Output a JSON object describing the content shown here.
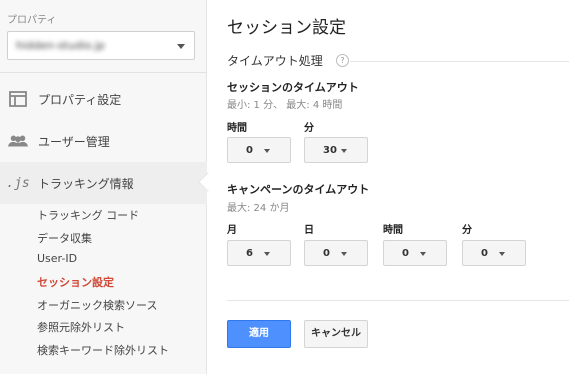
{
  "sidebar": {
    "property_label": "プロパティ",
    "property_value": "hidden-studio.jp",
    "nav": [
      {
        "label": "プロパティ設定",
        "icon": "layout-icon"
      },
      {
        "label": "ユーザー管理",
        "icon": "users-icon"
      },
      {
        "label": "トラッキング情報",
        "icon": "js-icon",
        "icon_text": ".js"
      }
    ],
    "sub_items": [
      "トラッキング コード",
      "データ収集",
      "User-ID",
      "セッション設定",
      "オーガニック検索ソース",
      "参照元除外リスト",
      "検索キーワード除外リスト"
    ],
    "selected_sub_item": "セッション設定",
    "selected_color": "#d14836"
  },
  "main": {
    "title": "セッション設定",
    "section_title": "タイムアウト処理",
    "help_glyph": "?",
    "session_timeout": {
      "title": "セッションのタイムアウト",
      "hint": "最小: 1 分、 最大: 4 時間",
      "hours_label": "時間",
      "hours_value": "0",
      "minutes_label": "分",
      "minutes_value": "30"
    },
    "campaign_timeout": {
      "title": "キャンペーンのタイムアウト",
      "hint": "最大: 24 か月",
      "months_label": "月",
      "months_value": "6",
      "days_label": "日",
      "days_value": "0",
      "hours_label": "時間",
      "hours_value": "0",
      "minutes_label": "分",
      "minutes_value": "0"
    },
    "apply_label": "適用",
    "cancel_label": "キャンセル",
    "primary_color": "#4d90fe"
  }
}
